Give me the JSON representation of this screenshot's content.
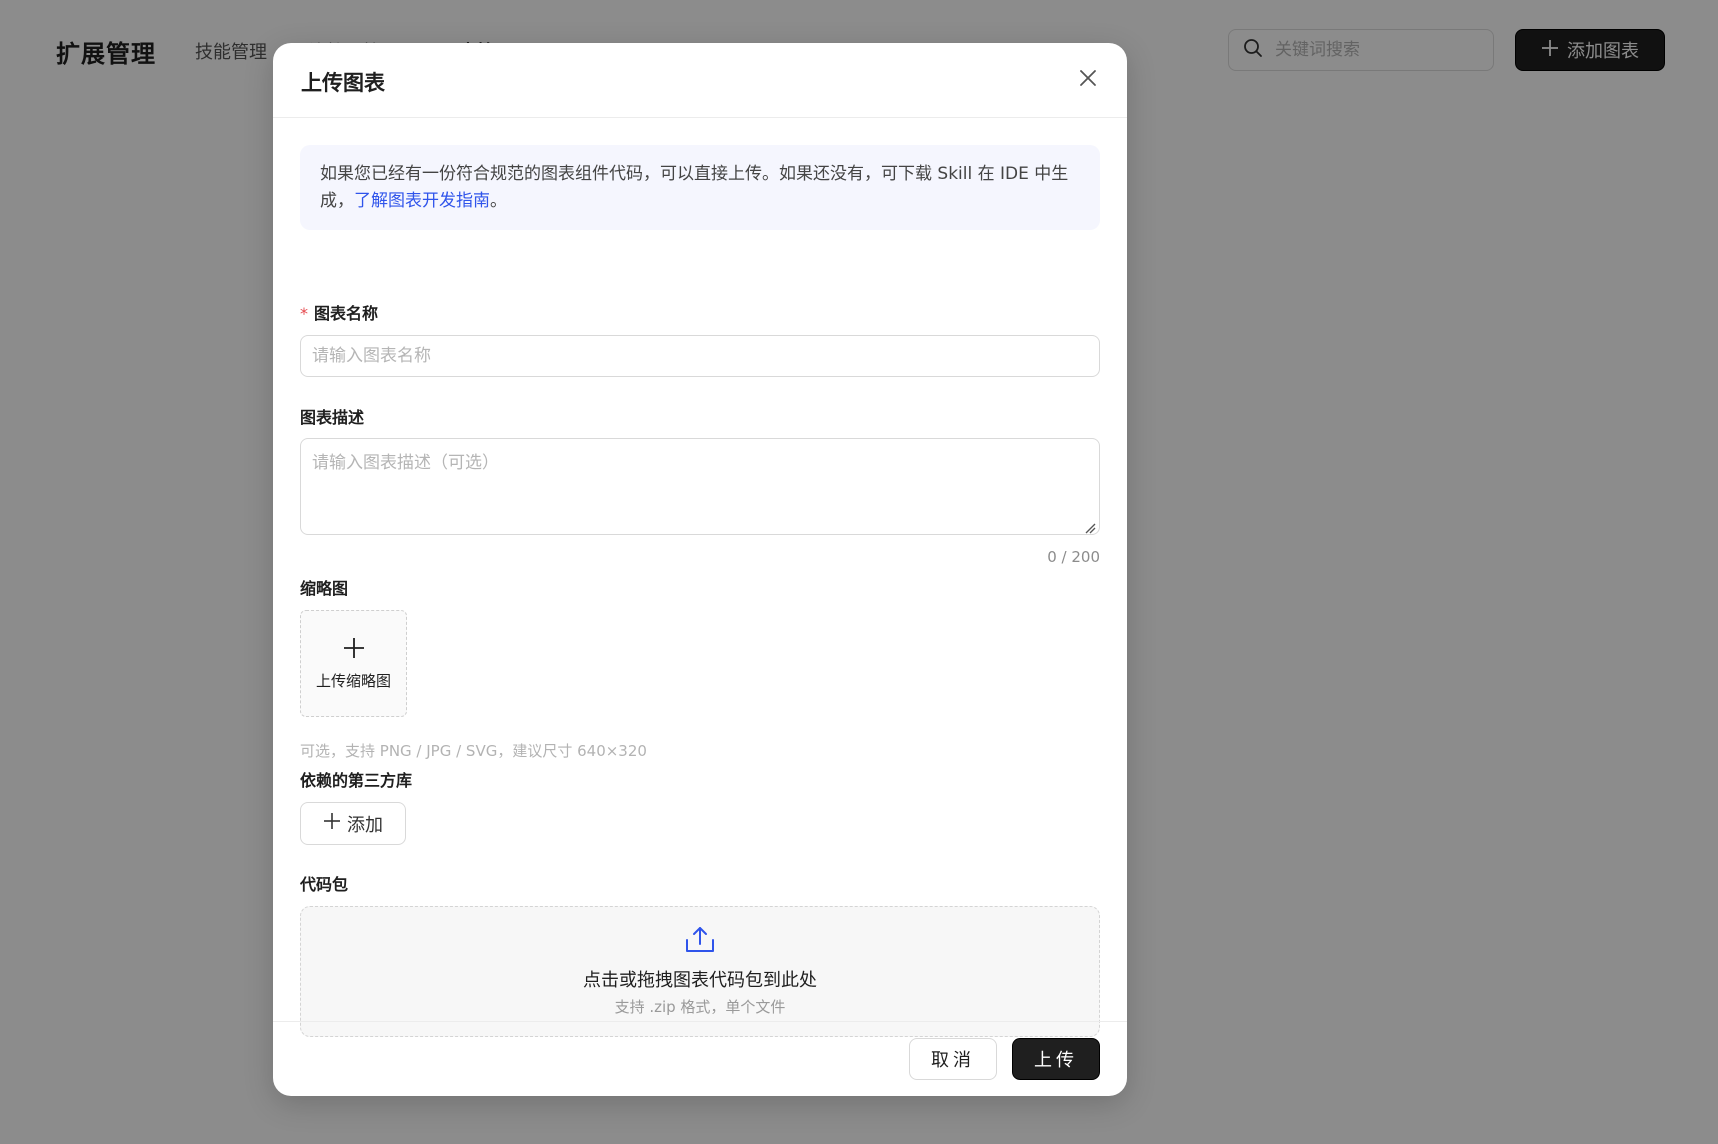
{
  "page": {
    "brand": "扩展管理",
    "tabs": [
      {
        "label": "技能管理"
      },
      {
        "label": "连接器管理"
      },
      {
        "label": "图表管理"
      }
    ],
    "search": {
      "placeholder": "关键词搜索"
    },
    "add_chart_label": "添加图表"
  },
  "modal": {
    "title": "上传图表",
    "info_text": "如果您已经有一份符合规范的图表组件代码，可以直接上传。如果还没有，可下载 Skill 在 IDE 中生成，",
    "info_link": "了解图表开发指南",
    "info_tail": "。",
    "name_field": {
      "required_mark": "*",
      "label": "图表名称",
      "placeholder": "请输入图表名称"
    },
    "desc_field": {
      "label": "图表描述",
      "placeholder": "请输入图表描述（可选）",
      "counter": "0 / 200"
    },
    "thumbnail": {
      "label": "缩略图",
      "button_label": "上传缩略图",
      "hint": "可选，支持 PNG / JPG / SVG，建议尺寸 640×320"
    },
    "dependencies": {
      "label": "依赖的第三方库",
      "add_label": "添加"
    },
    "code_package": {
      "label": "代码包",
      "drop_title": "点击或拖拽图表代码包到此处",
      "drop_subtitle": "支持 .zip 格式，单个文件"
    },
    "footer": {
      "cancel_label": "取消",
      "submit_label": "上传"
    }
  },
  "colors": {
    "overlay": "#000000",
    "primary_button": "#1f1f1f",
    "link": "#2f54eb",
    "required": "#e5484d",
    "info_bg": "#f5f6fe"
  },
  "icons": {
    "search": "search-icon",
    "plus": "plus-icon",
    "close": "close-icon",
    "upload": "upload-icon",
    "resize": "resize-handle-icon"
  }
}
